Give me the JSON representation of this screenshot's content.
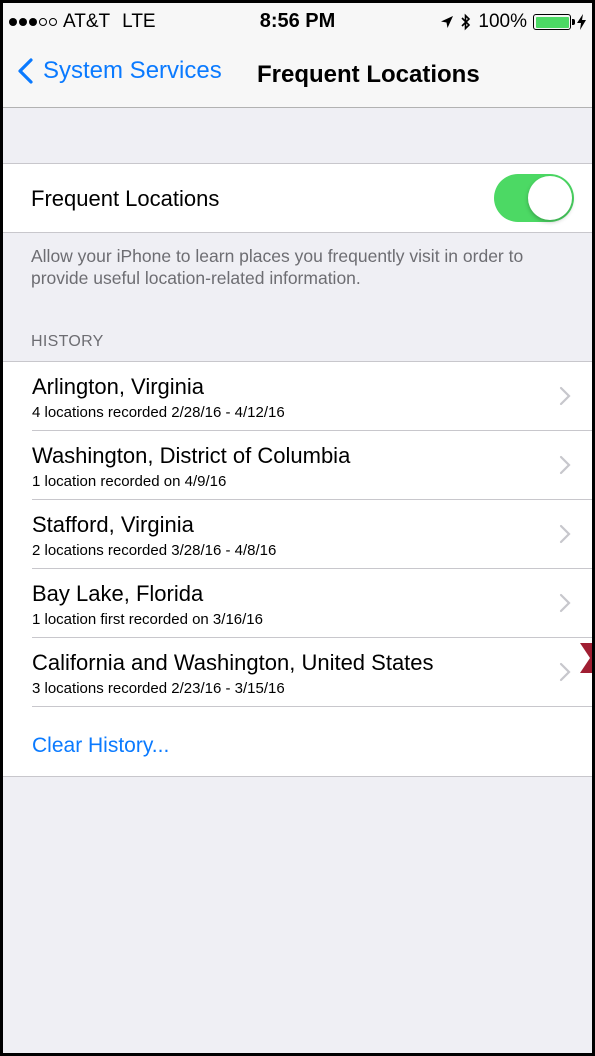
{
  "status_bar": {
    "signal_dots": [
      "filled",
      "filled",
      "filled",
      "empty",
      "empty"
    ],
    "carrier": "AT&T",
    "network": "LTE",
    "time": "8:56 PM",
    "battery_text": "100%",
    "battery_level": 1.0,
    "icons": [
      "location-arrow-icon",
      "bluetooth-icon",
      "battery-icon",
      "charging-bolt-icon"
    ]
  },
  "nav": {
    "back_label": "System Services",
    "title": "Frequent Locations"
  },
  "setting": {
    "label": "Frequent Locations",
    "enabled": true,
    "description": "Allow your iPhone to learn places you frequently visit in order to provide useful location-related information."
  },
  "history": {
    "header": "HISTORY",
    "items": [
      {
        "title": "Arlington, Virginia",
        "subtitle": "4 locations recorded 2/28/16 - 4/12/16"
      },
      {
        "title": "Washington, District of Columbia",
        "subtitle": "1 location recorded on 4/9/16"
      },
      {
        "title": "Stafford, Virginia",
        "subtitle": "2 locations recorded 3/28/16 - 4/8/16"
      },
      {
        "title": "Bay Lake, Florida",
        "subtitle": "1 location first recorded on 3/16/16"
      },
      {
        "title": "California and Washington, United States",
        "subtitle": "3 locations recorded 2/23/16 - 3/15/16"
      }
    ],
    "clear_label": "Clear History..."
  },
  "colors": {
    "accent": "#0a7aff",
    "switch_on": "#4cd964",
    "corner_marker": "#a01e32"
  }
}
